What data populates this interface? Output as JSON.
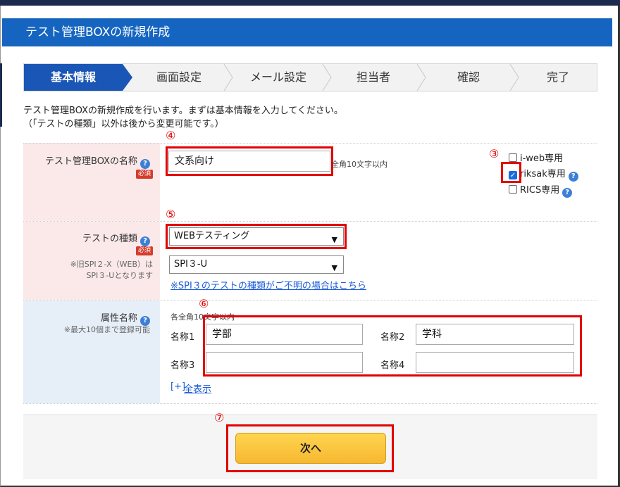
{
  "header": {
    "title": "テスト管理BOXの新規作成"
  },
  "steps": [
    "基本情報",
    "画面設定",
    "メール設定",
    "担当者",
    "確認",
    "完了"
  ],
  "intro": {
    "line1": "テスト管理BOXの新規作成を行います。まずは基本情報を入力してください。",
    "line2": "（「テストの種類」以外は後から変更可能です。）"
  },
  "annotations": {
    "n3": "③",
    "n4": "④",
    "n5": "⑤",
    "n6": "⑥",
    "n7": "⑦"
  },
  "name_row": {
    "label": "テスト管理BOXの名称",
    "required": "必須",
    "value": "文系向け",
    "hint": "全角10文字以内",
    "help": "?",
    "options": [
      {
        "label": "i-web専用",
        "checked": false
      },
      {
        "label": "riksak専用",
        "checked": true
      },
      {
        "label": "RICS専用",
        "checked": false
      }
    ]
  },
  "type_row": {
    "label": "テストの種類",
    "required": "必須",
    "note1": "※旧SPI２-X（WEB）は",
    "note2": "SPI３-Uとなります",
    "select1": "WEBテスティング",
    "select2": "SPI３-U",
    "link": "※SPI３のテストの種類がご不明の場合はこちら",
    "help": "?"
  },
  "attr_row": {
    "label": "属性名称",
    "note": "※最大10個まで登録可能",
    "hint": "各全角10文字以内",
    "help": "?",
    "fields": [
      {
        "label": "名称1",
        "value": "学部"
      },
      {
        "label": "名称2",
        "value": "学科"
      },
      {
        "label": "名称3",
        "value": ""
      },
      {
        "label": "名称4",
        "value": ""
      }
    ],
    "expand_prefix": "[+]",
    "expand_link": "全表示"
  },
  "footer": {
    "next_label": "次へ"
  },
  "colors": {
    "header": "#1565c0",
    "step_active": "#1a56b5",
    "annotation": "#e20000",
    "button": "#f7b731"
  }
}
